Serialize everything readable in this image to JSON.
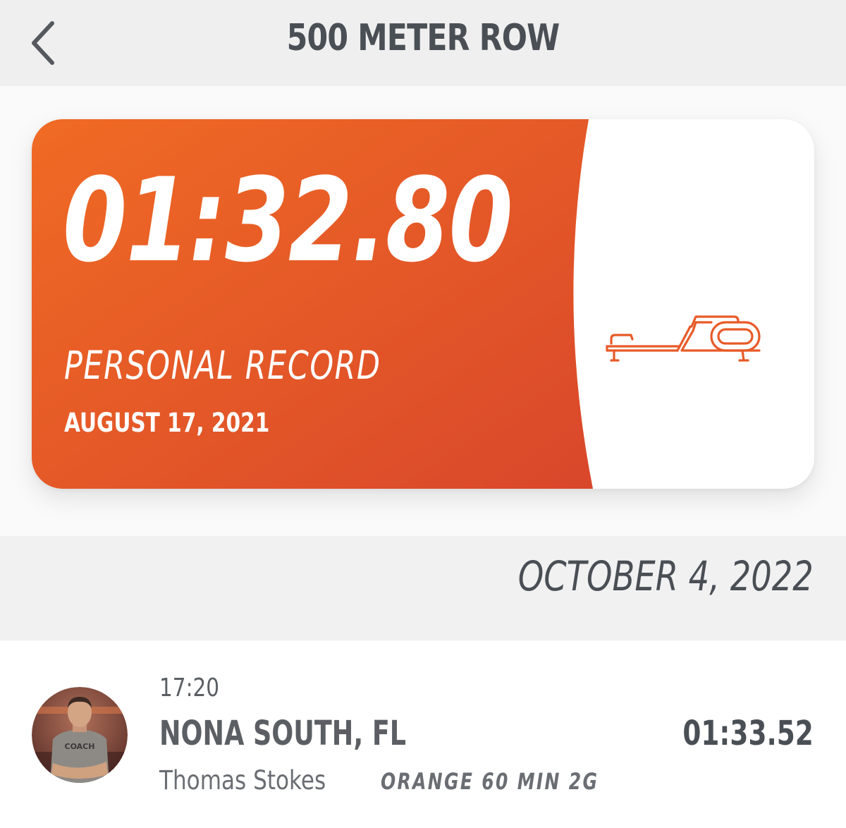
{
  "header": {
    "title": "500 METER ROW",
    "back_icon": "chevron-left-icon"
  },
  "personal_record": {
    "time": "01:32.80",
    "label": "PERSONAL RECORD",
    "date": "AUGUST 17, 2021",
    "icon": "rowing-machine-icon",
    "accent_color": "#ef6a26",
    "accent_color_dark": "#d9482b"
  },
  "sessions": [
    {
      "date": "OCTOBER 4, 2022",
      "time": "17:20",
      "studio": "NONA SOUTH, FL",
      "coach": "Thomas Stokes",
      "class_name": "ORANGE 60 MIN 2G",
      "result": "01:33.52",
      "avatar": "coach-avatar-photo"
    }
  ]
}
